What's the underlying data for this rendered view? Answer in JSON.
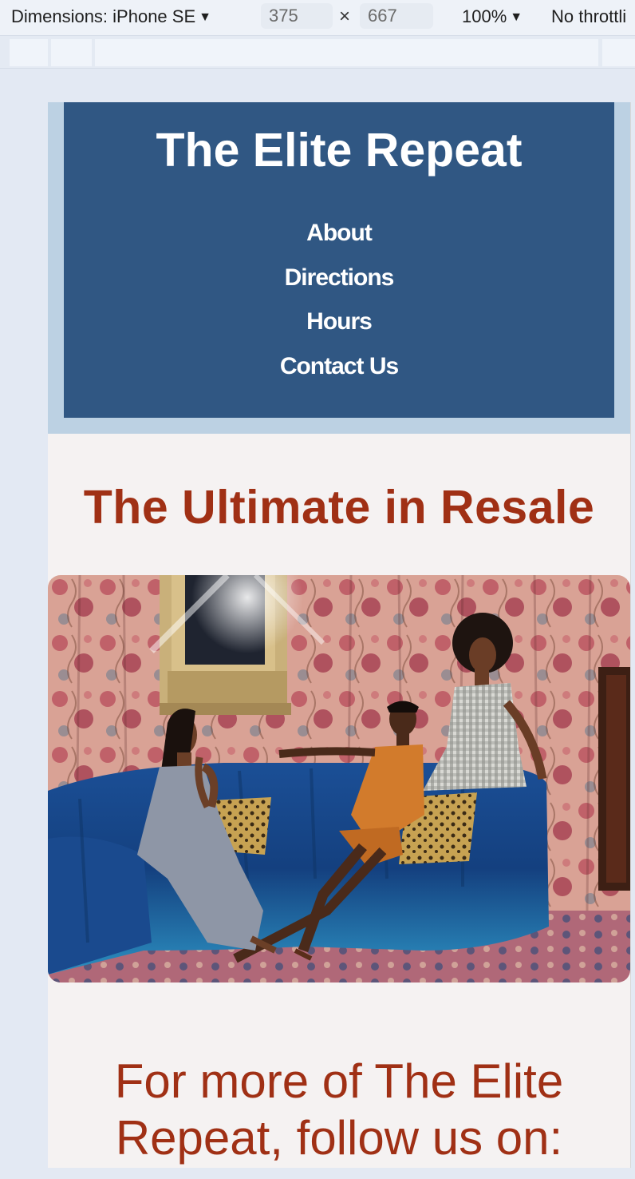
{
  "devtools": {
    "device_label": "Dimensions: iPhone SE",
    "width_value": "375",
    "height_value": "667",
    "times_symbol": "×",
    "zoom_label": "100%",
    "throttle_label": "No throttli",
    "caret": "▼"
  },
  "site": {
    "title": "The Elite Repeat",
    "nav": [
      "About",
      "Directions",
      "Hours",
      "Contact Us"
    ],
    "tagline": "The Ultimate in Resale",
    "follow_text": "For more of The Elite Repeat, follow us on:"
  },
  "colors": {
    "header_bg": "#305783",
    "header_frame": "#bcd1e3",
    "page_bg": "#f5f2f2",
    "accent_red": "#a03015"
  }
}
